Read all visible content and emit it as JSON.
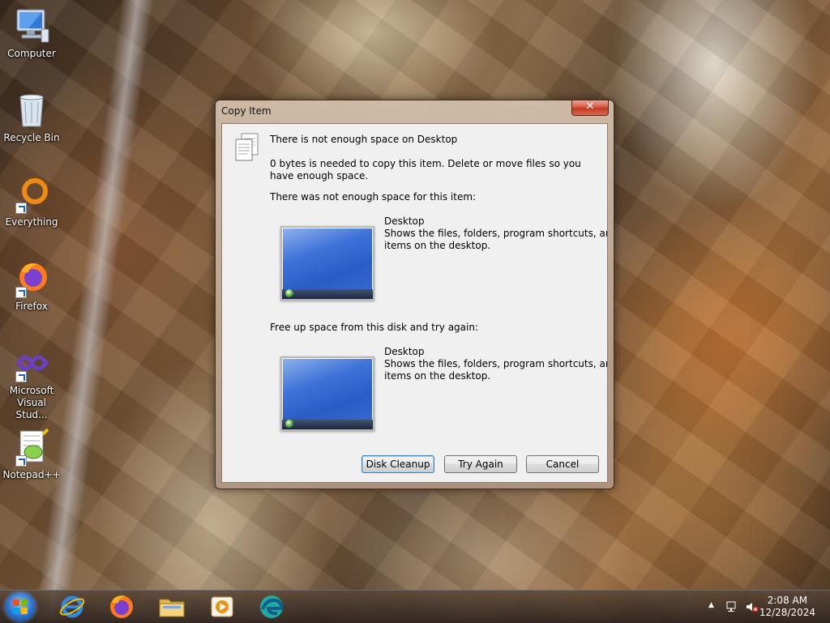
{
  "desktop": {
    "icons": [
      {
        "label": "Computer",
        "icon": "computer-icon"
      },
      {
        "label": "Recycle Bin",
        "icon": "recycle-bin-icon"
      },
      {
        "label": "Everything",
        "icon": "everything-icon"
      },
      {
        "label": "Firefox",
        "icon": "firefox-icon"
      },
      {
        "label": "Microsoft Visual Stud...",
        "icon": "visual-studio-icon"
      },
      {
        "label": "Notepad++",
        "icon": "notepad-plus-plus-icon"
      }
    ]
  },
  "dialog": {
    "title": "Copy Item",
    "close_label": "✕",
    "heading": "There is not enough space on Desktop",
    "message": "0 bytes is needed to copy this item. Delete or move files so you have enough space.",
    "section1_label": "There was not enough space for this item:",
    "section2_label": "Free up space from this disk and try again:",
    "item1": {
      "name": "Desktop",
      "desc_line1": "Shows the files, folders, program shortcuts, and othe",
      "desc_line2": "items on the desktop."
    },
    "item2": {
      "name": "Desktop",
      "desc_line1": "Shows the files, folders, program shortcuts, and othe",
      "desc_line2": "items on the desktop."
    },
    "buttons": {
      "disk_cleanup": "Disk Cleanup",
      "try_again": "Try Again",
      "cancel": "Cancel"
    }
  },
  "taskbar": {
    "apps": [
      "internet-explorer-icon",
      "firefox-icon",
      "file-explorer-icon",
      "media-player-icon",
      "edge-icon"
    ],
    "time": "2:08 AM",
    "date": "12/28/2024"
  }
}
